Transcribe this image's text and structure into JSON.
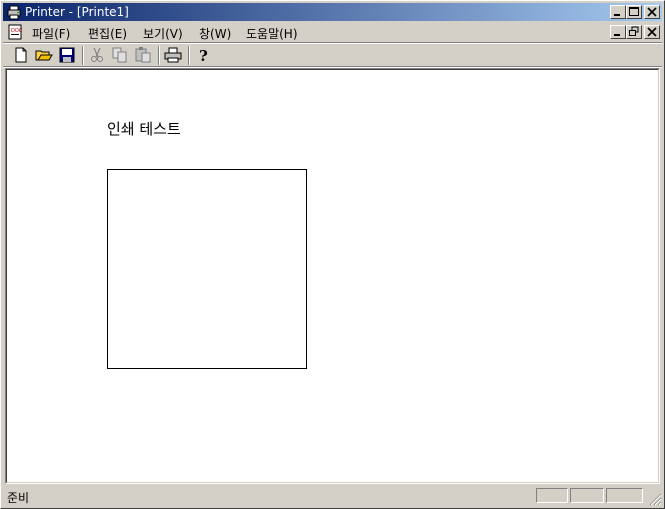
{
  "window": {
    "title": "Printer - [Printe1]"
  },
  "menu": {
    "file": "파일(F)",
    "edit": "편집(E)",
    "view": "보기(V)",
    "window": "창(W)",
    "help": "도움말(H)"
  },
  "toolbar": {
    "icons": [
      "new-icon",
      "open-icon",
      "save-icon",
      "cut-icon",
      "copy-icon",
      "paste-icon",
      "print-icon",
      "help-icon"
    ]
  },
  "document": {
    "text": "인쇄 테스트"
  },
  "status": {
    "text": "준비"
  },
  "colors": {
    "titlebar_start": "#0a246a",
    "titlebar_end": "#a6caf0",
    "face": "#d4d0c8"
  }
}
